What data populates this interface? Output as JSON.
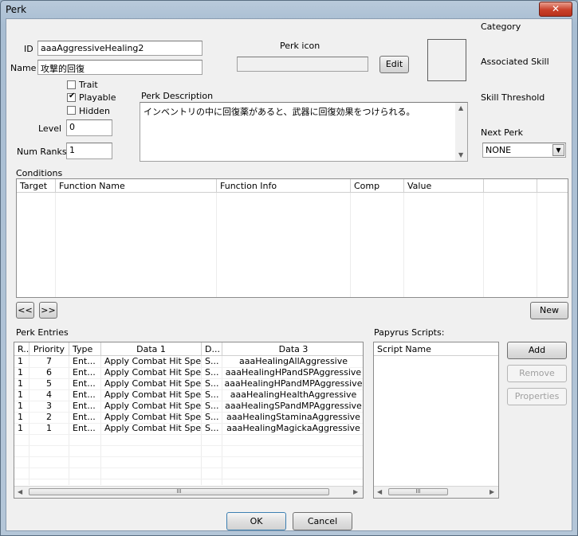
{
  "window": {
    "title": "Perk",
    "close_glyph": "✕"
  },
  "fields": {
    "id_label": "ID",
    "id_value": "aaaAggressiveHealing2",
    "name_label": "Name",
    "name_value": "攻撃的回復",
    "trait_label": "Trait",
    "playable_label": "Playable",
    "hidden_label": "Hidden",
    "trait_checked": false,
    "playable_checked": true,
    "hidden_checked": false,
    "level_label": "Level",
    "level_value": "0",
    "numranks_label": "Num Ranks",
    "numranks_value": "1",
    "perk_icon_label": "Perk icon",
    "edit_label": "Edit",
    "description_label": "Perk Description",
    "description_value": "インベントリの中に回復薬があると、武器に回復効果をつけられる。"
  },
  "right_panel": {
    "category_label": "Category",
    "associated_skill_label": "Associated Skill",
    "skill_threshold_label": "Skill Threshold",
    "next_perk_label": "Next Perk",
    "next_perk_value": "NONE"
  },
  "conditions": {
    "label": "Conditions",
    "columns": [
      "Target",
      "Function Name",
      "Function Info",
      "Comp",
      "Value"
    ],
    "prev_label": "<<",
    "next_label": ">>",
    "new_label": "New"
  },
  "perk_entries": {
    "label": "Perk Entries",
    "columns": [
      "R..",
      "Priority",
      "Type",
      "Data 1",
      "D...",
      "Data 3"
    ],
    "rows": [
      [
        "1",
        "7",
        "Ent...",
        "Apply Combat Hit Spell",
        "S...",
        "aaaHealingAllAggressive"
      ],
      [
        "1",
        "6",
        "Ent...",
        "Apply Combat Hit Spell",
        "S...",
        "aaaHealingHPandSPAggressive"
      ],
      [
        "1",
        "5",
        "Ent...",
        "Apply Combat Hit Spell",
        "S...",
        "aaaHealingHPandMPAggressive"
      ],
      [
        "1",
        "4",
        "Ent...",
        "Apply Combat Hit Spell",
        "S...",
        "aaaHealingHealthAggressive"
      ],
      [
        "1",
        "3",
        "Ent...",
        "Apply Combat Hit Spell",
        "S...",
        "aaaHealingSPandMPAggressive"
      ],
      [
        "1",
        "2",
        "Ent...",
        "Apply Combat Hit Spell",
        "S...",
        "aaaHealingStaminaAggressive"
      ],
      [
        "1",
        "1",
        "Ent...",
        "Apply Combat Hit Spell",
        "S...",
        "aaaHealingMagickaAggressive"
      ]
    ]
  },
  "papyrus": {
    "label": "Papyrus Scripts:",
    "column": "Script Name",
    "add_label": "Add",
    "remove_label": "Remove",
    "properties_label": "Properties"
  },
  "dialog": {
    "ok_label": "OK",
    "cancel_label": "Cancel"
  },
  "scroll": {
    "left": "◀",
    "right": "▶",
    "up": "▲",
    "down": "▼",
    "grip": "III"
  }
}
